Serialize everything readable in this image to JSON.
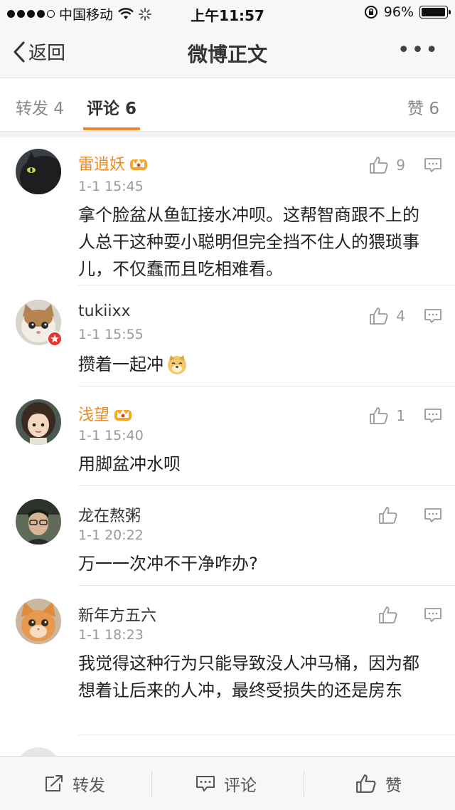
{
  "status_bar": {
    "carrier": "中国移动",
    "time": "上午11:57",
    "battery": "96%",
    "battery_level": 0.96
  },
  "nav": {
    "back_label": "返回",
    "title": "微博正文",
    "more_label": "•••"
  },
  "tabs": {
    "repost": "转发 4",
    "comment": "评论 6",
    "like": "赞 6"
  },
  "comments": [
    {
      "name": "雷逍妖",
      "vip": true,
      "time": "1-1 15:45",
      "text": "拿个脸盆从鱼缸接水冲呗。这帮智商跟不上的人总干这种耍小聪明但完全挡不住人的猥琐事儿，不仅蠢而且吃相难看。",
      "likes": "9"
    },
    {
      "name": "tukiixx",
      "vip": false,
      "verified": true,
      "time": "1-1 15:55",
      "text": "攒着一起冲",
      "emoji": "doge",
      "likes": "4"
    },
    {
      "name": "浅望",
      "vip": true,
      "time": "1-1 15:40",
      "text": "用脚盆冲水呗",
      "likes": "1"
    },
    {
      "name": "龙在熬粥",
      "vip": false,
      "time": "1-1 20:22",
      "text": "万一一次冲不干净咋办?",
      "likes": ""
    },
    {
      "name": "新年方五六",
      "vip": false,
      "time": "1-1 18:23",
      "text": "我觉得这种行为只能导致没人冲马桶，因为都想着让后来的人冲，最终受损失的还是房东",
      "likes": ""
    }
  ],
  "toolbar": {
    "repost": "转发",
    "comment": "评论",
    "like": "赞"
  },
  "colors": {
    "accent": "#f08a24",
    "bar_bg": "#f7f7f7",
    "muted": "#999999"
  }
}
